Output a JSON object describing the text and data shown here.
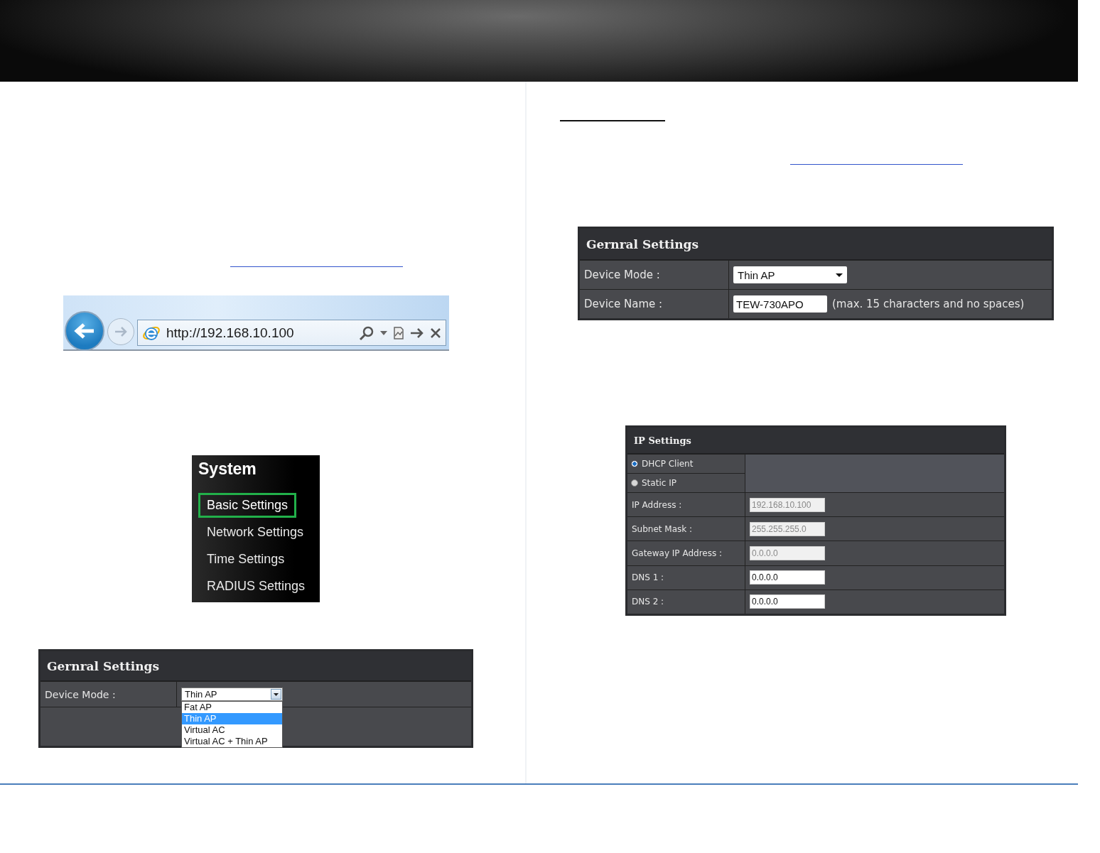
{
  "browser_bar": {
    "address": "http://192.168.10.100"
  },
  "system_menu": {
    "title": "System",
    "items": [
      {
        "label": "Basic Settings",
        "selected": true
      },
      {
        "label": "Network Settings",
        "selected": false
      },
      {
        "label": "Time Settings",
        "selected": false
      },
      {
        "label": "RADIUS Settings",
        "selected": false
      }
    ]
  },
  "device_mode_dropdown": {
    "title": "Gernral Settings",
    "label": "Device Mode :",
    "value": "Thin AP",
    "expanded": true,
    "options": [
      {
        "label": "Fat AP",
        "selected": false
      },
      {
        "label": "Thin AP",
        "selected": true
      },
      {
        "label": "Virtual AC",
        "selected": false
      },
      {
        "label": "Virtual AC + Thin AP",
        "selected": false
      }
    ]
  },
  "general_settings": {
    "title": "Gernral Settings",
    "rows": [
      {
        "kind": "select",
        "label": "Device Mode :",
        "value": "Thin AP"
      },
      {
        "kind": "text",
        "label": "Device Name :",
        "value": "TEW-730APO",
        "note": "(max. 15 characters and no spaces)"
      }
    ]
  },
  "ip_settings": {
    "title": "IP Settings",
    "modes": [
      {
        "label": "DHCP Client",
        "selected": true
      },
      {
        "label": "Static IP",
        "selected": false
      }
    ],
    "fields": [
      {
        "label": "IP Address :",
        "value": "192.168.10.100",
        "disabled": true
      },
      {
        "label": "Subnet Mask :",
        "value": "255.255.255.0",
        "disabled": true
      },
      {
        "label": "Gateway IP Address :",
        "value": "0.0.0.0",
        "disabled": true
      },
      {
        "label": "DNS 1 :",
        "value": "0.0.0.0",
        "disabled": false
      },
      {
        "label": "DNS 2 :",
        "value": "0.0.0.0",
        "disabled": false
      }
    ]
  }
}
